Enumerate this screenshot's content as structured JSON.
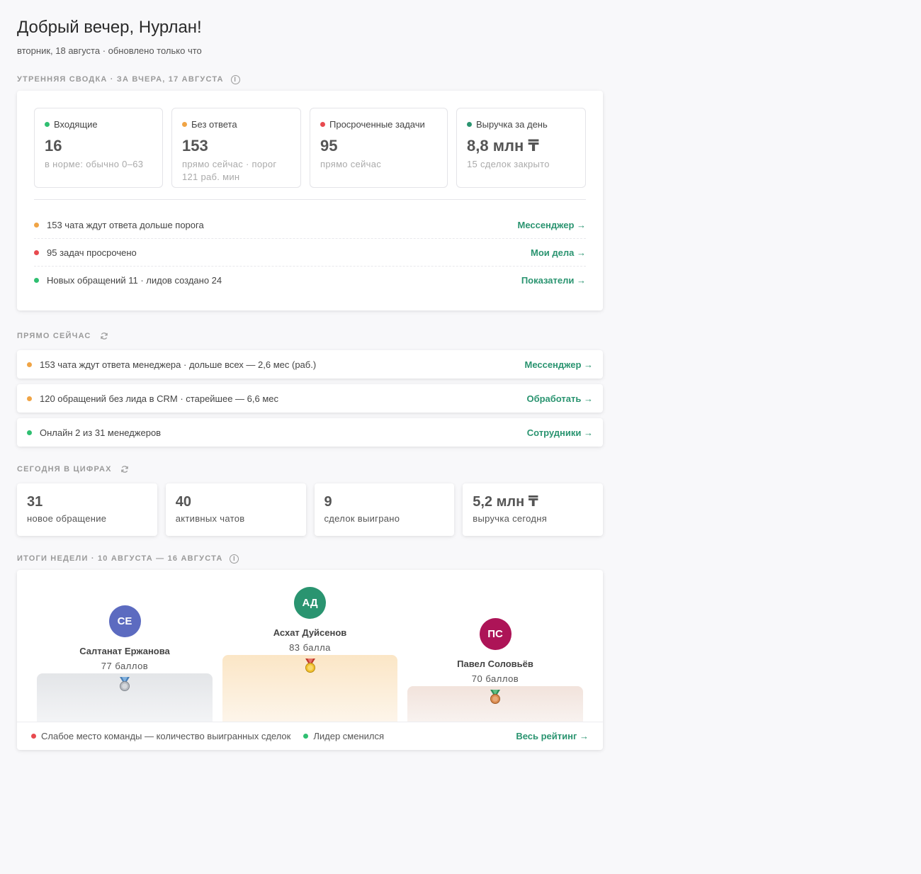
{
  "header": {
    "greeting": "Добрый вечер, Нурлан!",
    "subtitle": "вторник, 18 августа · обновлено только что"
  },
  "morning": {
    "title": "УТРЕННЯЯ СВОДКА · ЗА ВЧЕРА, 17 АВГУСТА",
    "kpis": [
      {
        "label": "Входящие",
        "value": "16",
        "hint": "в норме: обычно 0–63",
        "color": "#2fbf71"
      },
      {
        "label": "Без ответа",
        "value": "153",
        "hint": "прямо сейчас · порог 121 раб. мин",
        "color": "#f0a445"
      },
      {
        "label": "Просроченные задачи",
        "value": "95",
        "hint": "прямо сейчас",
        "color": "#e84a4f"
      },
      {
        "label": "Выручка за день",
        "value": "8,8 млн ₸",
        "hint": "15 сделок закрыто",
        "color": "#2a9470"
      }
    ],
    "items": [
      {
        "text": "153 чата ждут ответа дольше порога",
        "link": "Мессенджер →",
        "color": "#f0a445"
      },
      {
        "text": "95 задач просрочено",
        "link": "Мои дела →",
        "color": "#e84a4f"
      },
      {
        "text": "Новых обращений 11 · лидов создано 24",
        "link": "Показатели →",
        "color": "#2fbf71"
      }
    ]
  },
  "now": {
    "title": "ПРЯМО СЕЙЧАС",
    "items": [
      {
        "text": "153 чата ждут ответа менеджера · дольше всех — 2,6 мес (раб.)",
        "link": "Мессенджер →",
        "color": "#f0a445"
      },
      {
        "text": "120 обращений без лида в CRM · старейшее — 6,6 мес",
        "link": "Обработать →",
        "color": "#f0a445"
      },
      {
        "text": "Онлайн 2 из 31 менеджеров",
        "link": "Сотрудники →",
        "color": "#2fbf71"
      }
    ]
  },
  "today": {
    "title": "СЕГОДНЯ В ЦИФРАХ",
    "cards": [
      {
        "value": "31",
        "label": "новое обращение"
      },
      {
        "value": "40",
        "label": "активных чатов"
      },
      {
        "value": "9",
        "label": "сделок выиграно"
      },
      {
        "value": "5,2 млн ₸",
        "label": "выручка сегодня"
      }
    ]
  },
  "week": {
    "title": "ИТОГИ НЕДЕЛИ · 10 АВГУСТА — 16 АВГУСТА",
    "podium": [
      {
        "initials": "СЕ",
        "name": "Салтанат Ержанова",
        "score": "77 баллов",
        "color": "#5c6bc0",
        "place": 2
      },
      {
        "initials": "АД",
        "name": "Асхат Дуйсенов",
        "score": "83 балла",
        "color": "#2a9470",
        "place": 1
      },
      {
        "initials": "ПС",
        "name": "Павел Соловьёв",
        "score": "70 баллов",
        "color": "#ad1457",
        "place": 3
      }
    ],
    "footer": {
      "weak": "Слабое место команды — количество выигранных сделок",
      "leader": "Лидер сменился",
      "link": "Весь рейтинг →",
      "weak_color": "#e84a4f",
      "leader_color": "#2fbf71"
    }
  }
}
